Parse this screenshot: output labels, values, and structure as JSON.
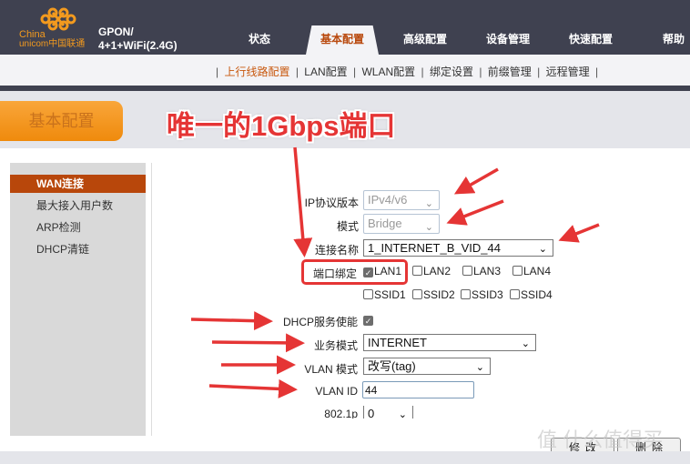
{
  "header": {
    "logo_line1": "China",
    "logo_line2": "unicom中国联通",
    "product_line1": "GPON/",
    "product_line2": "4+1+WiFi(2.4G)",
    "tabs": [
      {
        "label": "状态"
      },
      {
        "label": "基本配置",
        "active": true
      },
      {
        "label": "高级配置"
      },
      {
        "label": "设备管理"
      },
      {
        "label": "快速配置"
      },
      {
        "label": "帮助"
      }
    ]
  },
  "subnav": {
    "items": [
      {
        "label": "上行线路配置",
        "active": true
      },
      {
        "label": "LAN配置"
      },
      {
        "label": "WLAN配置"
      },
      {
        "label": "绑定设置"
      },
      {
        "label": "前缀管理"
      },
      {
        "label": "远程管理"
      }
    ],
    "separator": "|"
  },
  "section_title": "基本配置",
  "sidebar": {
    "items": [
      {
        "label": "WAN连接",
        "active": true
      },
      {
        "label": "最大接入用户数"
      },
      {
        "label": "ARP检测"
      },
      {
        "label": "DHCP清链"
      }
    ]
  },
  "form": {
    "ip_version": {
      "label": "IP协议版本",
      "value": "IPv4/v6"
    },
    "mode": {
      "label": "模式",
      "value": "Bridge"
    },
    "conn_name": {
      "label": "连接名称",
      "value": "1_INTERNET_B_VID_44"
    },
    "port_binding": {
      "label": "端口绑定",
      "ports": [
        {
          "label": "LAN1",
          "checked": true
        },
        {
          "label": "LAN2",
          "checked": false
        },
        {
          "label": "LAN3",
          "checked": false
        },
        {
          "label": "LAN4",
          "checked": false
        },
        {
          "label": "SSID1",
          "checked": false
        },
        {
          "label": "SSID2",
          "checked": false
        },
        {
          "label": "SSID3",
          "checked": false
        },
        {
          "label": "SSID4",
          "checked": false
        }
      ]
    },
    "dhcp_enable": {
      "label": "DHCP服务使能",
      "checked": true
    },
    "service_mode": {
      "label": "业务模式",
      "value": "INTERNET"
    },
    "vlan_mode": {
      "label": "VLAN 模式",
      "value": "改写(tag)"
    },
    "vlan_id": {
      "label": "VLAN ID",
      "value": "44"
    },
    "dot1p": {
      "label": "802.1p",
      "value": "0"
    },
    "buttons": {
      "modify": "修改",
      "delete": "删除"
    }
  },
  "annotation": {
    "title": "唯一的1Gbps端口",
    "color": "#e53535"
  },
  "watermark": "值 什么值得买",
  "colors": {
    "header_bg": "#3f4150",
    "accent": "#b8470b",
    "section_orange": "#f39a1e"
  }
}
